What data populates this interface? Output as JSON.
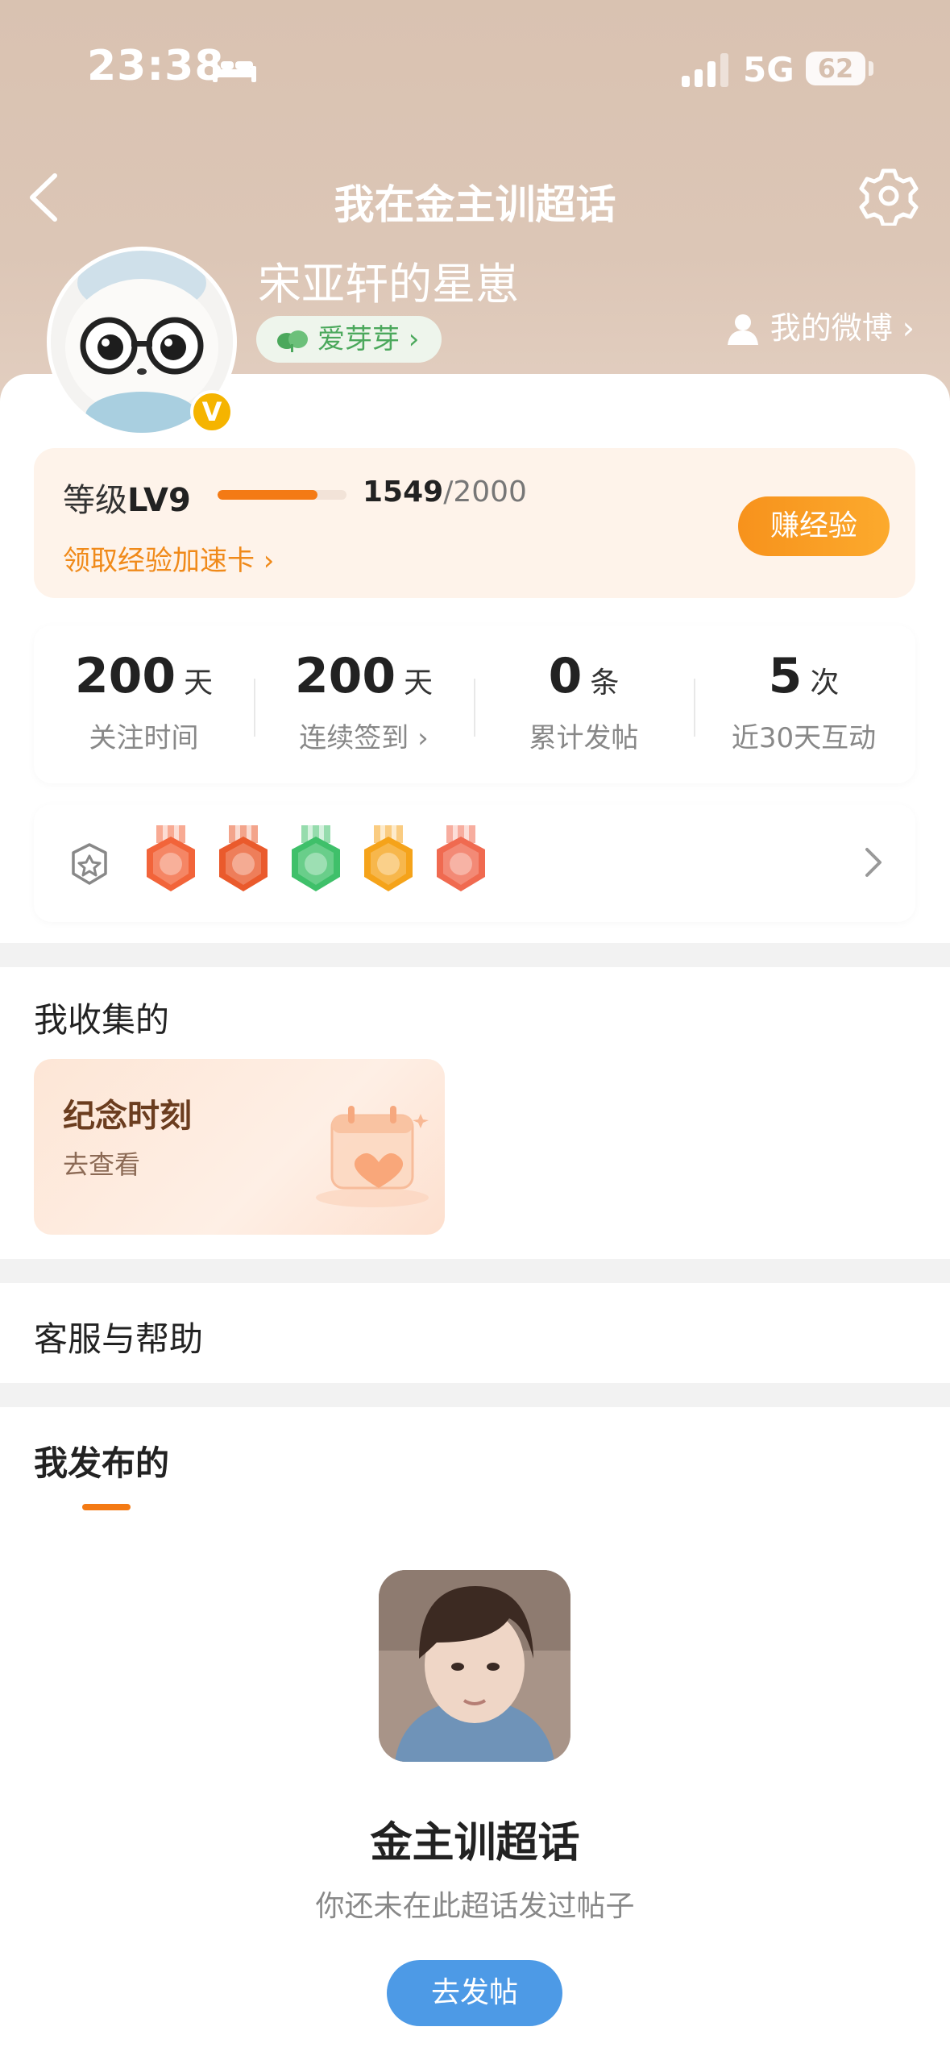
{
  "status_bar": {
    "time": "23:38",
    "network": "5G",
    "battery": "62"
  },
  "nav": {
    "title": "我在金主训超话"
  },
  "profile": {
    "username": "宋亚轩的星崽",
    "fan_tag": "爱芽芽 ›",
    "my_weibo": "我的微博 ›",
    "verified_mark": "V"
  },
  "level": {
    "label_prefix": "等级",
    "level": "LV9",
    "exp_current": "1549",
    "exp_total": "/2000",
    "progress_fraction": 0.7745,
    "boost_link": "领取经验加速卡 ›",
    "earn_button": "赚经验"
  },
  "stats": [
    {
      "value": "200",
      "unit": "天",
      "label": "关注时间"
    },
    {
      "value": "200",
      "unit": "天",
      "label": "连续签到 ›"
    },
    {
      "value": "0",
      "unit": "条",
      "label": "累计发帖"
    },
    {
      "value": "5",
      "unit": "次",
      "label": "近30天互动"
    }
  ],
  "badges": [
    {
      "icon": "lv9-medal",
      "color": "#f2643a"
    },
    {
      "icon": "100-days-medal",
      "color": "#ea5a2c"
    },
    {
      "icon": "wave-hand-medal",
      "color": "#3fc06a"
    },
    {
      "icon": "30-days-medal",
      "color": "#f5a31a"
    },
    {
      "icon": "rock-hand-medal",
      "color": "#f06a50"
    }
  ],
  "collected": {
    "title": "我收集的",
    "card_title": "纪念时刻",
    "card_sub": "去查看"
  },
  "help": {
    "title": "客服与帮助"
  },
  "posts": {
    "title": "我发布的",
    "topic_name": "金主训超话",
    "empty_hint": "你还未在此超话发过帖子",
    "post_button": "去发帖"
  },
  "colors": {
    "accent_orange": "#f47a14",
    "header_bg": "#d9c2b1",
    "post_button_blue": "#4d9ae6",
    "fan_tag_green": "#4ba85c"
  }
}
